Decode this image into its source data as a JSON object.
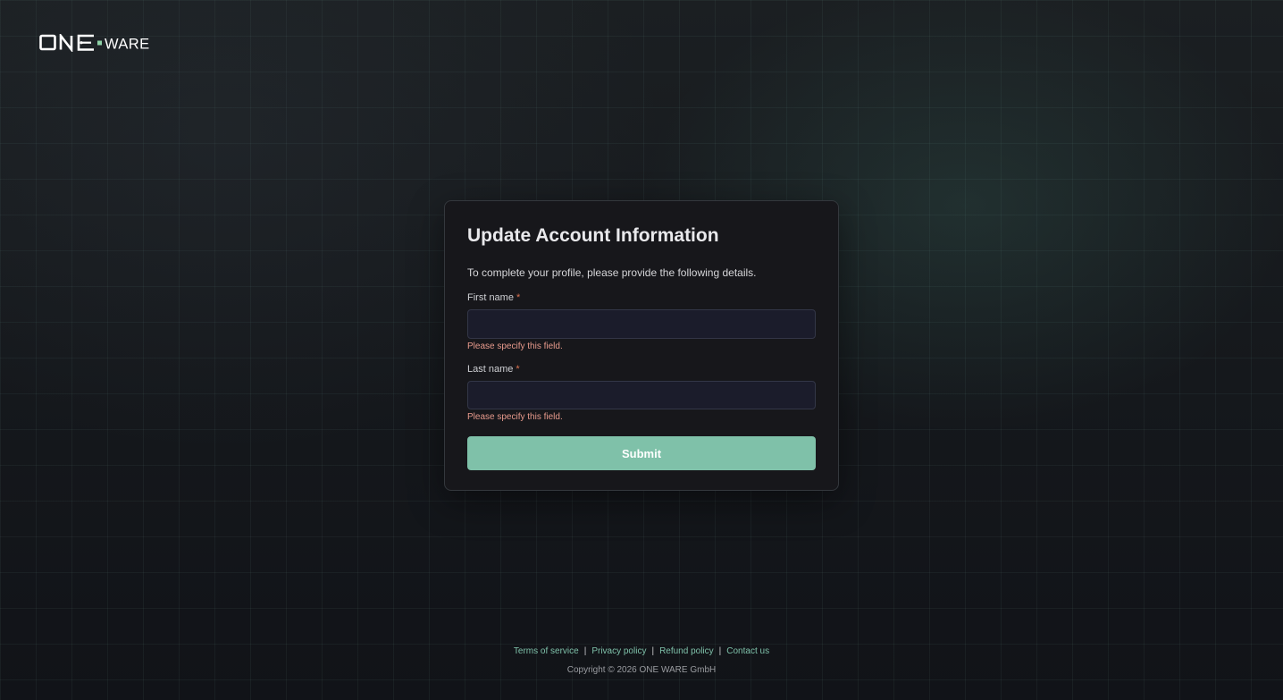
{
  "brand": {
    "logo_text_left": "ONE",
    "logo_text_right": "WARE",
    "accent_color": "#7fc1a9"
  },
  "form": {
    "title": "Update Account Information",
    "description": "To complete your profile, please provide the following details.",
    "fields": [
      {
        "label": "First name",
        "required_marker": "*",
        "value": "",
        "error": "Please specify this field."
      },
      {
        "label": "Last name",
        "required_marker": "*",
        "value": "",
        "error": "Please specify this field."
      }
    ],
    "submit_label": "Submit"
  },
  "footer": {
    "links": [
      {
        "label": "Terms of service"
      },
      {
        "label": "Privacy policy"
      },
      {
        "label": "Refund policy"
      },
      {
        "label": "Contact us"
      }
    ],
    "separator": "|",
    "copyright": "Copyright © 2026 ONE WARE GmbH"
  }
}
